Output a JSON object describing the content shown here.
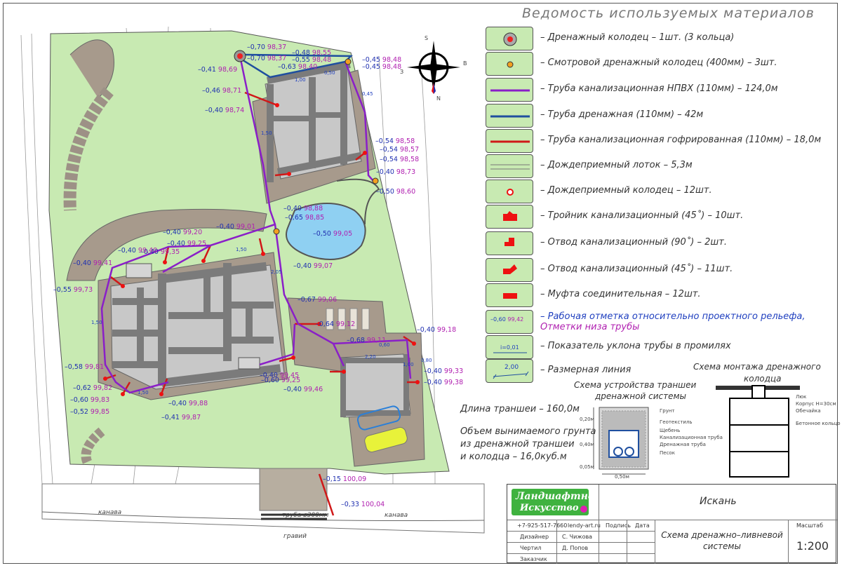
{
  "legend": {
    "title": "Ведомость используемых материалов",
    "items": [
      {
        "icon": "drainage-well-icon",
        "text": "– Дренажный колодец – 1шт. (3 кольца)"
      },
      {
        "icon": "inspection-well-icon",
        "text": "– Смотровой дренажный колодец (400мм) – 3шт."
      },
      {
        "icon": "sewer-pipe-icon",
        "text": "– Труба канализационная НПВХ (110мм) – 124,0м"
      },
      {
        "icon": "drain-pipe-icon",
        "text": "– Труба дренажная (110мм) – 42м"
      },
      {
        "icon": "corrugated-pipe-icon",
        "text": "– Труба канализационная гофрированная (110мм) – 18,0м"
      },
      {
        "icon": "rain-gutter-icon",
        "text": "– Дождеприемный лоток – 5,3м"
      },
      {
        "icon": "rain-well-icon",
        "text": "– Дождеприемный колодец – 12шт."
      },
      {
        "icon": "tee-45-icon",
        "text": "– Тройник канализационный (45˚) – 10шт."
      },
      {
        "icon": "elbow-90-icon",
        "text": "– Отвод канализационный (90˚) – 2шт."
      },
      {
        "icon": "elbow-45-icon",
        "text": "– Отвод канализационный (45˚) – 11шт."
      },
      {
        "icon": "coupling-icon",
        "text": "– Муфта соединительная – 12шт."
      },
      {
        "icon": "elevation-mark-icon",
        "text": "– Рабочая отметка относительно проектного рельефа,",
        "text2": "Отметки низа трубы",
        "sym_a": "–0,60",
        "sym_b": "99,42"
      },
      {
        "icon": "slope-indicator-icon",
        "text": "– Показатель уклона трубы в промилях",
        "sym_a": "i=0,01"
      },
      {
        "icon": "dimension-line-icon",
        "text": "– Размерная линия",
        "sym_a": "2,00"
      }
    ]
  },
  "notes": {
    "trench_length": "Длина траншеи – 160,0м",
    "soil_1": "Объем вынимаемого грунта",
    "soil_2": "из дренажной траншеи",
    "soil_3": "и колодца – 16,0куб.м"
  },
  "trench_scheme": {
    "title_1": "Схема устройства траншеи",
    "title_2": "дренажной системы",
    "labels": [
      "Грунт",
      "Геотекстиль",
      "Щебень",
      "Канализационная труба",
      "Дренажная труба",
      "Песок"
    ],
    "dims": [
      "0,20м",
      "0,40м",
      "0,05м",
      "0,50м"
    ]
  },
  "well_scheme": {
    "title_1": "Схема монтажа дренажного",
    "title_2": "колодца",
    "labels": [
      "Люк",
      "Корпус Н=30см",
      "Обечайка",
      "Бетонное кольцо"
    ]
  },
  "title_block": {
    "logo_1": "Ландшафтное",
    "logo_2": "Искусство",
    "project": "Искань",
    "phone": "+7-925-517-7660",
    "site": "lendy-art.ru",
    "col_sign": "Подпись",
    "col_date": "Дата",
    "row1_role": "Дизайнер",
    "row1_name": "С. Чижова",
    "row2_role": "Чертил",
    "row2_name": "Д. Попов",
    "row3_role": "Заказчик",
    "drawing": "Схема дренажно–ливневой системы",
    "scale_label": "Масштаб",
    "scale": "1:200"
  },
  "compass": {
    "n": "N",
    "s": "S",
    "w": "З",
    "e": "В"
  },
  "plan_labels": {
    "kanava_left": "канава",
    "kanava_right": "канава",
    "pipe": "труба ø300мм",
    "gravel": "гравий"
  },
  "elevations": [
    {
      "a": "–0,70",
      "b": "98,37"
    },
    {
      "a": "–0,48",
      "b": "98,55"
    },
    {
      "a": "–0,70",
      "b": "98,37"
    },
    {
      "a": "–0,55",
      "b": "98,48"
    },
    {
      "a": "–0,63",
      "b": "98,40"
    },
    {
      "a": "–0,45",
      "b": "98,48"
    },
    {
      "a": "–0,45",
      "b": "98,48"
    },
    {
      "a": "–0,41",
      "b": "98,69"
    },
    {
      "a": "–0,46",
      "b": "98,71"
    },
    {
      "a": "–0,40",
      "b": "98,74"
    },
    {
      "a": "–0,54",
      "b": "98,58"
    },
    {
      "a": "–0,54",
      "b": "98,57"
    },
    {
      "a": "–0,54",
      "b": "98,58"
    },
    {
      "a": "–0,40",
      "b": "98,73"
    },
    {
      "a": "–0,50",
      "b": "98,60"
    },
    {
      "a": "–0,40",
      "b": "98,88"
    },
    {
      "a": "–0,65",
      "b": "98,85"
    },
    {
      "a": "–0,50",
      "b": "99,05"
    },
    {
      "a": "–0,40",
      "b": "99,01"
    },
    {
      "a": "–0,40",
      "b": "99,20"
    },
    {
      "a": "–0,40",
      "b": "99,25"
    },
    {
      "a": "–0,40",
      "b": "99,35"
    },
    {
      "a": "–0,40",
      "b": "99,40"
    },
    {
      "a": "–0,40",
      "b": "99,41"
    },
    {
      "a": "–0,40",
      "b": "99,07"
    },
    {
      "a": "–0,55",
      "b": "99,73"
    },
    {
      "a": "–0,67",
      "b": "99,06"
    },
    {
      "a": "–0,64",
      "b": "99,12"
    },
    {
      "a": "–0,68",
      "b": "99,11"
    },
    {
      "a": "–0,40",
      "b": "99,18"
    },
    {
      "a": "–0,58",
      "b": "99,81"
    },
    {
      "a": "–0,62",
      "b": "99,82"
    },
    {
      "a": "–0,60",
      "b": "99,83"
    },
    {
      "a": "–0,52",
      "b": "99,85"
    },
    {
      "a": "–0,40",
      "b": "99,88"
    },
    {
      "a": "–0,41",
      "b": "99,87"
    },
    {
      "a": "–0,40",
      "b": "99,45"
    },
    {
      "a": "–0,60",
      "b": "99,25"
    },
    {
      "a": "–0,40",
      "b": "99,46"
    },
    {
      "a": "–0,40",
      "b": "99,33"
    },
    {
      "a": "–0,40",
      "b": "99,38"
    },
    {
      "a": "–0,15",
      "b": "100,09"
    },
    {
      "a": "–0,33",
      "b": "100,04"
    }
  ],
  "dimensions": [
    "1,50",
    "1,50",
    "1,50",
    "0,50",
    "2,05",
    "2,20",
    "0,80",
    "1,00",
    "1,50",
    "0,45",
    "1,00",
    "0,60"
  ],
  "colors": {
    "grass": "#c8eab2",
    "paving": "#a79a8c",
    "building": "#c4c4c4",
    "walls": "#7a7a7a",
    "sewer": "#8a1fc8",
    "drain": "#1f4f9f",
    "corrugated": "#d01818",
    "pool": "#8fd0f2",
    "elev_blue": "#2030b0",
    "elev_mag": "#b01fb0"
  }
}
